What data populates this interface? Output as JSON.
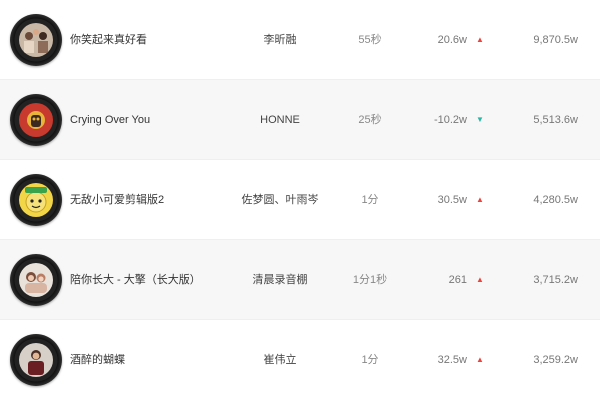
{
  "songs": [
    {
      "title": "你笑起来真好看",
      "artist": "李昕融",
      "duration": "55秒",
      "change": "20.6w",
      "trend": "up",
      "total": "9,870.5w"
    },
    {
      "title": "Crying Over You",
      "artist": "HONNE",
      "duration": "25秒",
      "change": "-10.2w",
      "trend": "down",
      "total": "5,513.6w"
    },
    {
      "title": "无敌小可爱剪辑版2",
      "artist": "佐梦圆、叶雨岑",
      "duration": "1分",
      "change": "30.5w",
      "trend": "up",
      "total": "4,280.5w"
    },
    {
      "title": "陪你长大 - 大擎（长大版）",
      "artist": "清晨录音棚",
      "duration": "1分1秒",
      "change": "261",
      "trend": "up",
      "total": "3,715.2w"
    },
    {
      "title": "酒醉的蝴蝶",
      "artist": "崔伟立",
      "duration": "1分",
      "change": "32.5w",
      "trend": "up",
      "total": "3,259.2w"
    }
  ],
  "icons": {
    "up": "▲",
    "down": "▼"
  },
  "colors": {
    "up": "#e9443f",
    "down": "#2cb6a6",
    "alt_row": "#f7f7f7"
  }
}
